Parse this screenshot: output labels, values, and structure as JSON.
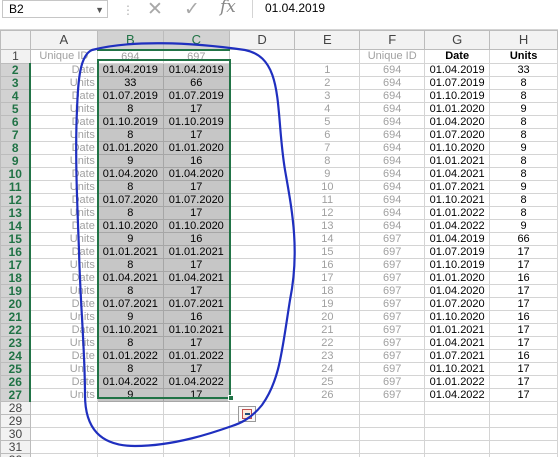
{
  "formula_bar": {
    "name_box": "B2",
    "formula": "01.04.2019",
    "cancel_icon": "✕",
    "enter_icon": "✓",
    "fx_label": "fx"
  },
  "columns": [
    "A",
    "B",
    "C",
    "D",
    "E",
    "F",
    "G",
    "H"
  ],
  "row_numbers": [
    "1",
    "2",
    "3",
    "4",
    "5",
    "6",
    "7",
    "8",
    "9",
    "10",
    "11",
    "12",
    "13",
    "14",
    "15",
    "16",
    "17",
    "18",
    "19",
    "20",
    "21",
    "22",
    "23",
    "24",
    "25",
    "26",
    "27",
    "28",
    "29",
    "30",
    "31",
    "32"
  ],
  "row1": {
    "a": "Unique ID",
    "b": "694",
    "c": "697",
    "f": "Unique ID",
    "g": "Date",
    "h": "Units"
  },
  "left_rows": [
    {
      "a": "Date",
      "b": "01.04.2019",
      "c": "01.04.2019"
    },
    {
      "a": "Units",
      "b": "33",
      "c": "66"
    },
    {
      "a": "Date",
      "b": "01.07.2019",
      "c": "01.07.2019"
    },
    {
      "a": "Units",
      "b": "8",
      "c": "17"
    },
    {
      "a": "Date",
      "b": "01.10.2019",
      "c": "01.10.2019"
    },
    {
      "a": "Units",
      "b": "8",
      "c": "17"
    },
    {
      "a": "Date",
      "b": "01.01.2020",
      "c": "01.01.2020"
    },
    {
      "a": "Units",
      "b": "9",
      "c": "16"
    },
    {
      "a": "Date",
      "b": "01.04.2020",
      "c": "01.04.2020"
    },
    {
      "a": "Units",
      "b": "8",
      "c": "17"
    },
    {
      "a": "Date",
      "b": "01.07.2020",
      "c": "01.07.2020"
    },
    {
      "a": "Units",
      "b": "8",
      "c": "17"
    },
    {
      "a": "Date",
      "b": "01.10.2020",
      "c": "01.10.2020"
    },
    {
      "a": "Units",
      "b": "9",
      "c": "16"
    },
    {
      "a": "Date",
      "b": "01.01.2021",
      "c": "01.01.2021"
    },
    {
      "a": "Units",
      "b": "8",
      "c": "17"
    },
    {
      "a": "Date",
      "b": "01.04.2021",
      "c": "01.04.2021"
    },
    {
      "a": "Units",
      "b": "8",
      "c": "17"
    },
    {
      "a": "Date",
      "b": "01.07.2021",
      "c": "01.07.2021"
    },
    {
      "a": "Units",
      "b": "9",
      "c": "16"
    },
    {
      "a": "Date",
      "b": "01.10.2021",
      "c": "01.10.2021"
    },
    {
      "a": "Units",
      "b": "8",
      "c": "17"
    },
    {
      "a": "Date",
      "b": "01.01.2022",
      "c": "01.01.2022"
    },
    {
      "a": "Units",
      "b": "8",
      "c": "17"
    },
    {
      "a": "Date",
      "b": "01.04.2022",
      "c": "01.04.2022"
    },
    {
      "a": "Units",
      "b": "9",
      "c": "17"
    }
  ],
  "right_rows": [
    {
      "e": "1",
      "f": "694",
      "g": "01.04.2019",
      "h": "33"
    },
    {
      "e": "2",
      "f": "694",
      "g": "01.07.2019",
      "h": "8"
    },
    {
      "e": "3",
      "f": "694",
      "g": "01.10.2019",
      "h": "8"
    },
    {
      "e": "4",
      "f": "694",
      "g": "01.01.2020",
      "h": "9"
    },
    {
      "e": "5",
      "f": "694",
      "g": "01.04.2020",
      "h": "8"
    },
    {
      "e": "6",
      "f": "694",
      "g": "01.07.2020",
      "h": "8"
    },
    {
      "e": "7",
      "f": "694",
      "g": "01.10.2020",
      "h": "9"
    },
    {
      "e": "8",
      "f": "694",
      "g": "01.01.2021",
      "h": "8"
    },
    {
      "e": "9",
      "f": "694",
      "g": "01.04.2021",
      "h": "8"
    },
    {
      "e": "10",
      "f": "694",
      "g": "01.07.2021",
      "h": "9"
    },
    {
      "e": "11",
      "f": "694",
      "g": "01.10.2021",
      "h": "8"
    },
    {
      "e": "12",
      "f": "694",
      "g": "01.01.2022",
      "h": "8"
    },
    {
      "e": "13",
      "f": "694",
      "g": "01.04.2022",
      "h": "9"
    },
    {
      "e": "14",
      "f": "697",
      "g": "01.04.2019",
      "h": "66"
    },
    {
      "e": "15",
      "f": "697",
      "g": "01.07.2019",
      "h": "17"
    },
    {
      "e": "16",
      "f": "697",
      "g": "01.10.2019",
      "h": "17"
    },
    {
      "e": "17",
      "f": "697",
      "g": "01.01.2020",
      "h": "16"
    },
    {
      "e": "18",
      "f": "697",
      "g": "01.04.2020",
      "h": "17"
    },
    {
      "e": "19",
      "f": "697",
      "g": "01.07.2020",
      "h": "17"
    },
    {
      "e": "20",
      "f": "697",
      "g": "01.10.2020",
      "h": "16"
    },
    {
      "e": "21",
      "f": "697",
      "g": "01.01.2021",
      "h": "17"
    },
    {
      "e": "22",
      "f": "697",
      "g": "01.04.2021",
      "h": "17"
    },
    {
      "e": "23",
      "f": "697",
      "g": "01.07.2021",
      "h": "16"
    },
    {
      "e": "24",
      "f": "697",
      "g": "01.10.2021",
      "h": "17"
    },
    {
      "e": "25",
      "f": "697",
      "g": "01.01.2022",
      "h": "17"
    },
    {
      "e": "26",
      "f": "697",
      "g": "01.04.2022",
      "h": "17"
    }
  ],
  "colors": {
    "selection_accent": "#217346",
    "selected_fill": "#c6c6c6",
    "annotation_ink": "#1f2fbf",
    "muted_text": "#a0a0a0"
  },
  "icons": {
    "cancel": "close-icon",
    "enter": "check-icon",
    "function": "fx-icon",
    "quick_analysis": "quick-analysis-icon"
  }
}
